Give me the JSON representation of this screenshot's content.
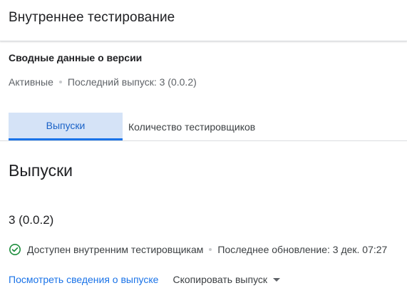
{
  "header": {
    "title": "Внутреннее тестирование"
  },
  "summary": {
    "heading": "Сводные данные о версии",
    "status": "Активные",
    "last_release": "Последний выпуск: 3 (0.0.2)"
  },
  "tabs": [
    {
      "label": "Выпуски",
      "active": true
    },
    {
      "label": "Количество тестировщиков",
      "active": false
    }
  ],
  "section": {
    "title": "Выпуски"
  },
  "release": {
    "name": "3 (0.0.2)",
    "availability": "Доступен внутренним тестировщикам",
    "updated": "Последнее обновление: 3 дек. 07:27",
    "status_icon": "check-circle-icon",
    "view_details_label": "Посмотреть сведения о выпуске",
    "copy_label": "Скопировать выпуск",
    "copy_icon": "caret-down-icon"
  },
  "colors": {
    "accent": "#1a73e8",
    "tab_active_bg": "#d5e3f7",
    "success": "#1e8e3e"
  }
}
